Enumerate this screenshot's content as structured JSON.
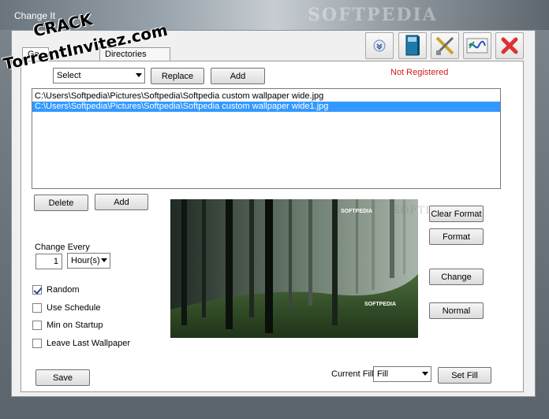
{
  "window": {
    "title": "Change It",
    "watermark": "SOFTPEDIA"
  },
  "overlay": {
    "line1": "CRACK",
    "line2": "TorrentInvitez.com"
  },
  "toolbar": {
    "buttons": [
      "dropdown-icon",
      "book-icon",
      "tools-icon",
      "link-icon",
      "close-icon"
    ]
  },
  "tabs": [
    {
      "label": "Ge"
    },
    {
      "label": "Directories"
    }
  ],
  "source_combo": {
    "value": "Select"
  },
  "buttons": {
    "replace": "Replace",
    "add_top": "Add",
    "delete": "Delete",
    "add_bottom": "Add",
    "clear_format": "Clear Format",
    "format": "Format",
    "change": "Change",
    "normal": "Normal",
    "save": "Save",
    "set_fill": "Set Fill"
  },
  "status": {
    "registration": "Not Registered",
    "color": "#d41a1a"
  },
  "file_list": [
    {
      "path": "C:\\Users\\Softpedia\\Pictures\\Softpedia\\Softpedia custom wallpaper wide.jpg",
      "selected": false
    },
    {
      "path": "C:\\Users\\Softpedia\\Pictures\\Softpedia\\Softpedia custom wallpaper wide1.jpg",
      "selected": true
    }
  ],
  "change_every": {
    "label": "Change Every",
    "value": "1",
    "unit": "Hour(s)"
  },
  "options": [
    {
      "label": "Random",
      "checked": true
    },
    {
      "label": "Use Schedule",
      "checked": false
    },
    {
      "label": "Min on Startup",
      "checked": false
    },
    {
      "label": "Leave Last Wallpaper",
      "checked": false
    }
  ],
  "fill": {
    "label": "Current Fill",
    "value": "Fill"
  },
  "preview": {
    "logo_top": "SOFTPEDIA",
    "logo_bottom": "SOFTPEDIA",
    "side_watermark": "SOFTPEDIA"
  }
}
